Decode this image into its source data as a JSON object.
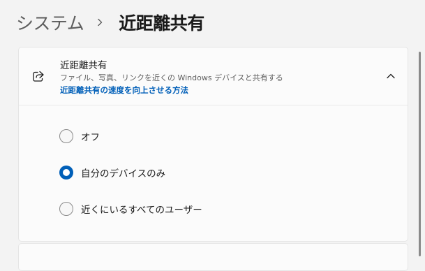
{
  "breadcrumb": {
    "parent": "システム",
    "current": "近距離共有"
  },
  "nearby_sharing": {
    "title": "近距離共有",
    "description": "ファイル、写真、リンクを近くの Windows デバイスと共有する",
    "link": "近距離共有の速度を向上させる方法",
    "options": [
      {
        "label": "オフ",
        "selected": false
      },
      {
        "label": "自分のデバイスのみ",
        "selected": true
      },
      {
        "label": "近くにいるすべてのユーザー",
        "selected": false
      }
    ]
  },
  "colors": {
    "accent": "#005fb8",
    "background": "#f3f3f3",
    "card": "#fbfbfb"
  },
  "icons": {
    "share": "share-icon",
    "chevron_right": "chevron-right-icon",
    "chevron_up": "chevron-up-icon"
  }
}
